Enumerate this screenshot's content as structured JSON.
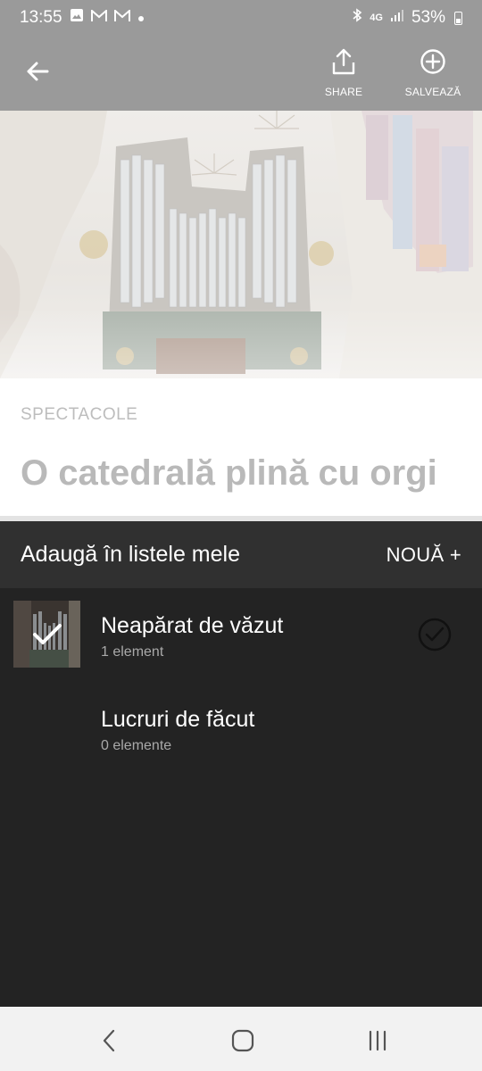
{
  "status_bar": {
    "time": "13:55",
    "battery": "53%",
    "icons": [
      "gallery-icon",
      "gmail-icon",
      "gmail-icon",
      "dot-icon",
      "bluetooth-icon",
      "4g-icon",
      "signal-icon",
      "battery-icon"
    ],
    "network": "4G"
  },
  "top_bar": {
    "share_label": "SHARE",
    "save_label": "SALVEAZĂ"
  },
  "article": {
    "category": "SPECTACOLE",
    "title": "O catedrală plină cu orgi"
  },
  "sheet": {
    "title": "Adaugă în listele mele",
    "new_label": "NOUĂ +",
    "lists": [
      {
        "name": "Neapărat de văzut",
        "count": "1 element",
        "checked": true
      },
      {
        "name": "Lucruri de făcut",
        "count": "0 elemente",
        "checked": false
      }
    ]
  },
  "colors": {
    "top_bar": "#9a9a9a",
    "sheet_bg": "#232323",
    "sheet_header": "#303030",
    "title_text": "#b9b9b9"
  }
}
